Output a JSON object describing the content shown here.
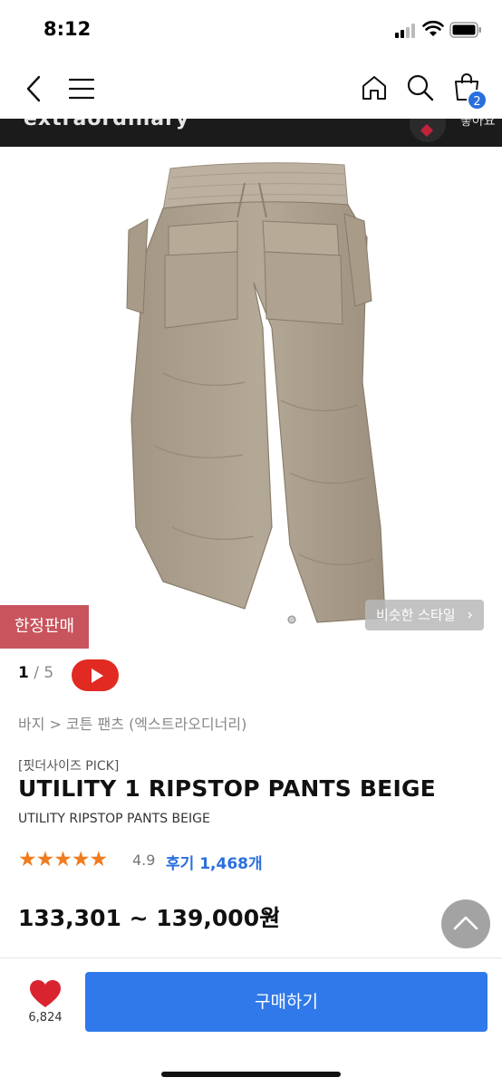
{
  "status_bar": {
    "time": "8:12"
  },
  "nav": {
    "cart_count": "2"
  },
  "brand_strip": {
    "brand_name": "extraordinary",
    "like_text": "좋아요"
  },
  "product": {
    "limited_badge": "한정판매",
    "similar_style_button": "비슷한 스타일",
    "pager": {
      "current": "1",
      "separator": "/",
      "total": "5"
    },
    "breadcrumb": "바지 > 코튼 팬츠 (엑스트라오디너리)",
    "pick_label": "[핏더사이즈 PICK]",
    "title": "UTILITY 1 RIPSTOP PANTS BEIGE",
    "subtitle": "UTILITY RIPSTOP PANTS BEIGE",
    "rating": {
      "stars": "★★★★★",
      "score": "4.9",
      "reviews": "후기 1,468개"
    },
    "price": "133,301 ~ 139,000원"
  },
  "bottom_bar": {
    "like_count": "6,824",
    "buy_label": "구매하기"
  },
  "colors": {
    "accent_blue": "#2f79ea",
    "limited_red": "#c8545e",
    "star_orange": "#f07c20",
    "video_red": "#e12a21"
  },
  "icons": [
    "back-icon",
    "menu-icon",
    "home-icon",
    "search-icon",
    "cart-icon",
    "play-icon",
    "heart-icon",
    "chevron-up-icon",
    "chevron-down-icon"
  ]
}
